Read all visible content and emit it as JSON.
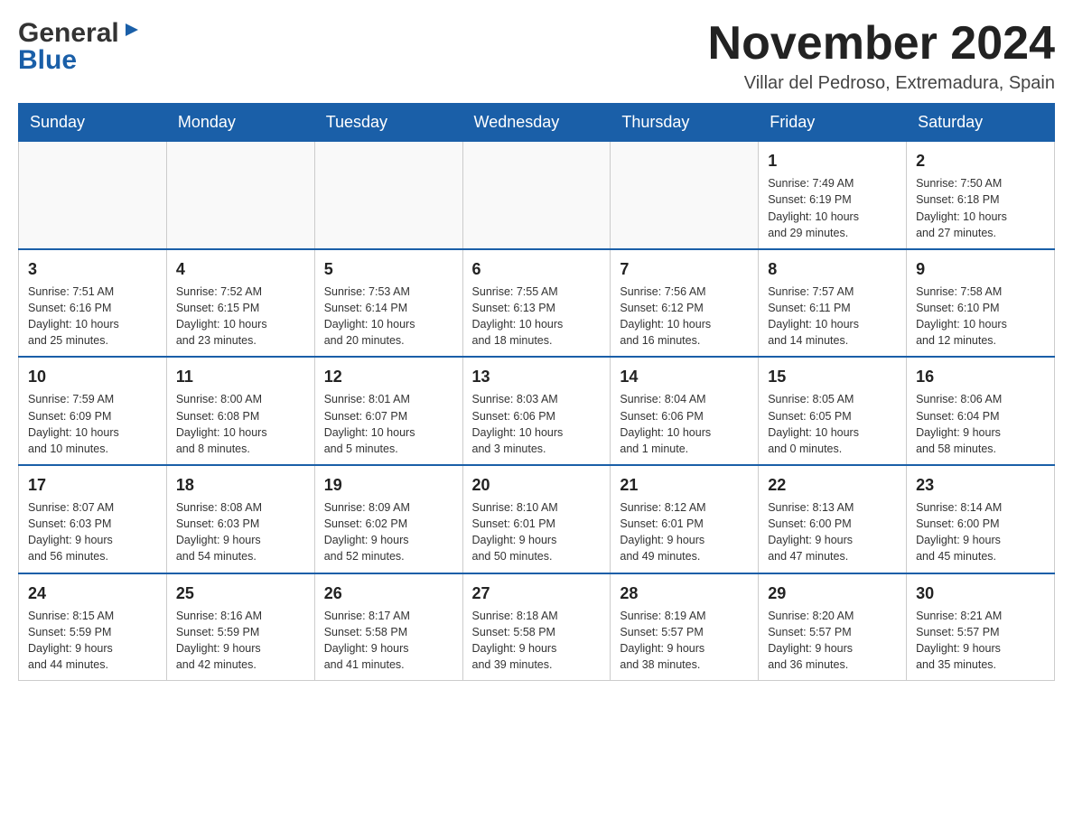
{
  "logo": {
    "general": "General",
    "blue": "Blue",
    "arrow": "▶"
  },
  "title": "November 2024",
  "location": "Villar del Pedroso, Extremadura, Spain",
  "weekdays": [
    "Sunday",
    "Monday",
    "Tuesday",
    "Wednesday",
    "Thursday",
    "Friday",
    "Saturday"
  ],
  "weeks": [
    {
      "days": [
        {
          "number": "",
          "info": ""
        },
        {
          "number": "",
          "info": ""
        },
        {
          "number": "",
          "info": ""
        },
        {
          "number": "",
          "info": ""
        },
        {
          "number": "",
          "info": ""
        },
        {
          "number": "1",
          "info": "Sunrise: 7:49 AM\nSunset: 6:19 PM\nDaylight: 10 hours\nand 29 minutes."
        },
        {
          "number": "2",
          "info": "Sunrise: 7:50 AM\nSunset: 6:18 PM\nDaylight: 10 hours\nand 27 minutes."
        }
      ]
    },
    {
      "days": [
        {
          "number": "3",
          "info": "Sunrise: 7:51 AM\nSunset: 6:16 PM\nDaylight: 10 hours\nand 25 minutes."
        },
        {
          "number": "4",
          "info": "Sunrise: 7:52 AM\nSunset: 6:15 PM\nDaylight: 10 hours\nand 23 minutes."
        },
        {
          "number": "5",
          "info": "Sunrise: 7:53 AM\nSunset: 6:14 PM\nDaylight: 10 hours\nand 20 minutes."
        },
        {
          "number": "6",
          "info": "Sunrise: 7:55 AM\nSunset: 6:13 PM\nDaylight: 10 hours\nand 18 minutes."
        },
        {
          "number": "7",
          "info": "Sunrise: 7:56 AM\nSunset: 6:12 PM\nDaylight: 10 hours\nand 16 minutes."
        },
        {
          "number": "8",
          "info": "Sunrise: 7:57 AM\nSunset: 6:11 PM\nDaylight: 10 hours\nand 14 minutes."
        },
        {
          "number": "9",
          "info": "Sunrise: 7:58 AM\nSunset: 6:10 PM\nDaylight: 10 hours\nand 12 minutes."
        }
      ]
    },
    {
      "days": [
        {
          "number": "10",
          "info": "Sunrise: 7:59 AM\nSunset: 6:09 PM\nDaylight: 10 hours\nand 10 minutes."
        },
        {
          "number": "11",
          "info": "Sunrise: 8:00 AM\nSunset: 6:08 PM\nDaylight: 10 hours\nand 8 minutes."
        },
        {
          "number": "12",
          "info": "Sunrise: 8:01 AM\nSunset: 6:07 PM\nDaylight: 10 hours\nand 5 minutes."
        },
        {
          "number": "13",
          "info": "Sunrise: 8:03 AM\nSunset: 6:06 PM\nDaylight: 10 hours\nand 3 minutes."
        },
        {
          "number": "14",
          "info": "Sunrise: 8:04 AM\nSunset: 6:06 PM\nDaylight: 10 hours\nand 1 minute."
        },
        {
          "number": "15",
          "info": "Sunrise: 8:05 AM\nSunset: 6:05 PM\nDaylight: 10 hours\nand 0 minutes."
        },
        {
          "number": "16",
          "info": "Sunrise: 8:06 AM\nSunset: 6:04 PM\nDaylight: 9 hours\nand 58 minutes."
        }
      ]
    },
    {
      "days": [
        {
          "number": "17",
          "info": "Sunrise: 8:07 AM\nSunset: 6:03 PM\nDaylight: 9 hours\nand 56 minutes."
        },
        {
          "number": "18",
          "info": "Sunrise: 8:08 AM\nSunset: 6:03 PM\nDaylight: 9 hours\nand 54 minutes."
        },
        {
          "number": "19",
          "info": "Sunrise: 8:09 AM\nSunset: 6:02 PM\nDaylight: 9 hours\nand 52 minutes."
        },
        {
          "number": "20",
          "info": "Sunrise: 8:10 AM\nSunset: 6:01 PM\nDaylight: 9 hours\nand 50 minutes."
        },
        {
          "number": "21",
          "info": "Sunrise: 8:12 AM\nSunset: 6:01 PM\nDaylight: 9 hours\nand 49 minutes."
        },
        {
          "number": "22",
          "info": "Sunrise: 8:13 AM\nSunset: 6:00 PM\nDaylight: 9 hours\nand 47 minutes."
        },
        {
          "number": "23",
          "info": "Sunrise: 8:14 AM\nSunset: 6:00 PM\nDaylight: 9 hours\nand 45 minutes."
        }
      ]
    },
    {
      "days": [
        {
          "number": "24",
          "info": "Sunrise: 8:15 AM\nSunset: 5:59 PM\nDaylight: 9 hours\nand 44 minutes."
        },
        {
          "number": "25",
          "info": "Sunrise: 8:16 AM\nSunset: 5:59 PM\nDaylight: 9 hours\nand 42 minutes."
        },
        {
          "number": "26",
          "info": "Sunrise: 8:17 AM\nSunset: 5:58 PM\nDaylight: 9 hours\nand 41 minutes."
        },
        {
          "number": "27",
          "info": "Sunrise: 8:18 AM\nSunset: 5:58 PM\nDaylight: 9 hours\nand 39 minutes."
        },
        {
          "number": "28",
          "info": "Sunrise: 8:19 AM\nSunset: 5:57 PM\nDaylight: 9 hours\nand 38 minutes."
        },
        {
          "number": "29",
          "info": "Sunrise: 8:20 AM\nSunset: 5:57 PM\nDaylight: 9 hours\nand 36 minutes."
        },
        {
          "number": "30",
          "info": "Sunrise: 8:21 AM\nSunset: 5:57 PM\nDaylight: 9 hours\nand 35 minutes."
        }
      ]
    }
  ]
}
